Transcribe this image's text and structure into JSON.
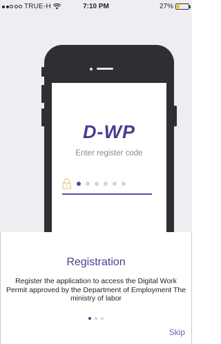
{
  "status_bar": {
    "carrier": "TRUE-H",
    "time": "7:10 PM",
    "battery": "27%",
    "battery_level": 0.27
  },
  "phone_screen": {
    "logo": "D-WP",
    "subtitle": "Enter register code",
    "pin_total": 6,
    "pin_filled": 1
  },
  "onboarding": {
    "title": "Registration",
    "description": "Register the application to access the Digital Work Permit approved by the Department of Employment The ministry of labor",
    "page_count": 3,
    "current_page": 1,
    "skip_label": "Skip"
  },
  "colors": {
    "brand": "#4a3d91",
    "accent": "#6d5fc0",
    "background_top": "#eeeef2",
    "battery": "#f2c200"
  }
}
